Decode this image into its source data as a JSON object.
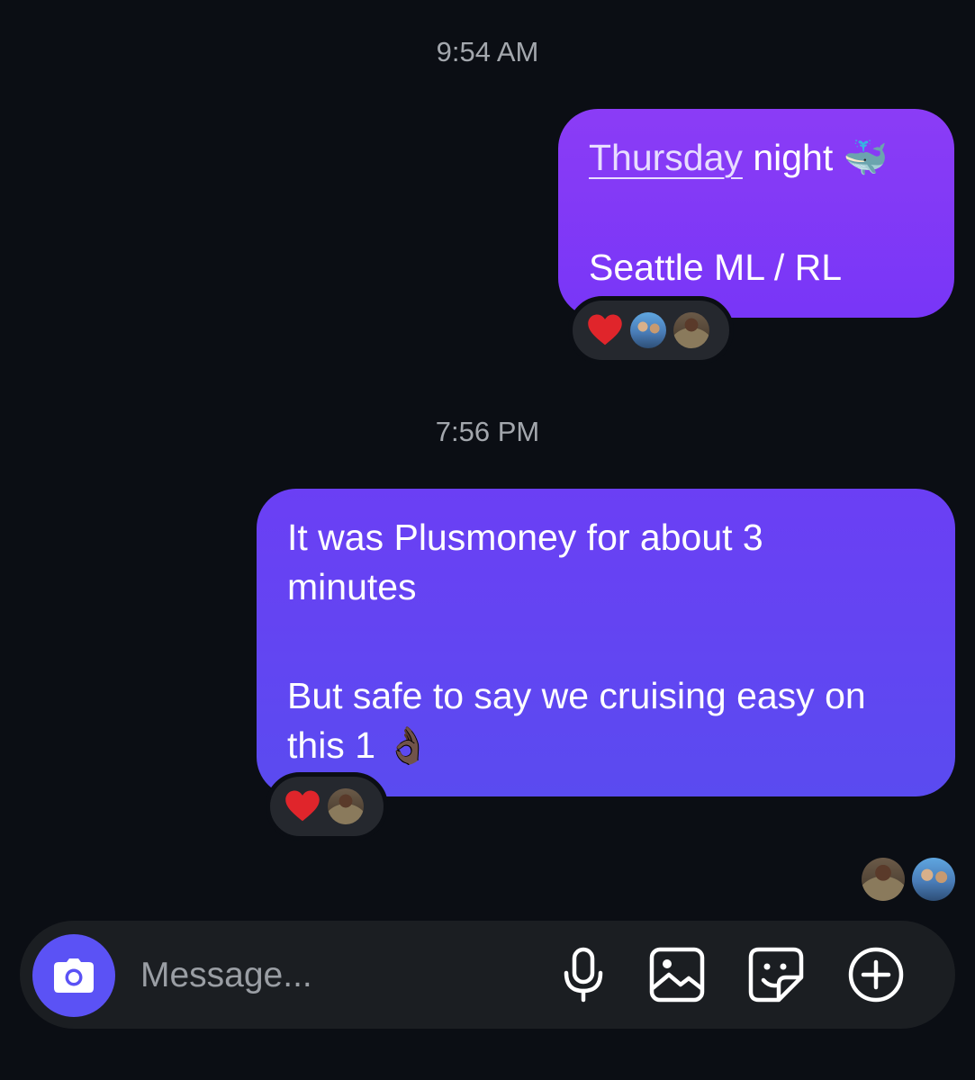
{
  "conversation": {
    "timestamp_1": "9:54 AM",
    "message_1": {
      "link_text": "Thursday",
      "line1_rest": " night",
      "line1_emoji": "🐳",
      "line2": "Seattle ML / RL",
      "reaction_emoji": "heart"
    },
    "timestamp_2": "7:56 PM",
    "message_2": {
      "line1": "It was Plusmoney for about 3",
      "line2": "minutes",
      "line3": "But safe to say we cruising easy on",
      "line4": "this 1",
      "line4_emoji": "👌🏿",
      "reaction_emoji": "heart"
    }
  },
  "composer": {
    "placeholder": "Message...",
    "icons": [
      "camera-icon",
      "microphone-icon",
      "gallery-icon",
      "sticker-icon",
      "plus-icon"
    ]
  },
  "colors": {
    "background": "#0b0e14",
    "bubble_top": "#8b3cf6",
    "bubble_bottom": "#5a4bf0",
    "camera_button": "#5b52f5",
    "composer_bg": "#1b1e22",
    "timestamp": "#a3a7ad",
    "heart": "#e0252b"
  }
}
